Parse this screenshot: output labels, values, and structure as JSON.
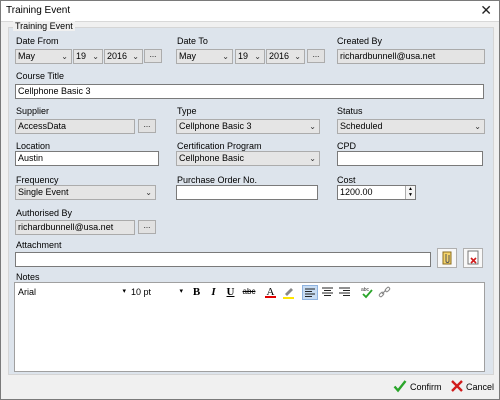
{
  "window": {
    "title": "Training Event"
  },
  "group": {
    "legend": "Training Event"
  },
  "date_from": {
    "label": "Date From",
    "month": "May",
    "day": "19",
    "year": "2016"
  },
  "date_to": {
    "label": "Date To",
    "month": "May",
    "day": "19",
    "year": "2016"
  },
  "created_by": {
    "label": "Created By",
    "value": "richardbunnell@usa.net"
  },
  "course_title": {
    "label": "Course Title",
    "value": "Cellphone Basic 3"
  },
  "supplier": {
    "label": "Supplier",
    "value": "AccessData"
  },
  "type": {
    "label": "Type",
    "value": "Cellphone Basic 3"
  },
  "status": {
    "label": "Status",
    "value": "Scheduled"
  },
  "location": {
    "label": "Location",
    "value": "Austin"
  },
  "certification_program": {
    "label": "Certification Program",
    "value": "Cellphone Basic"
  },
  "cpd": {
    "label": "CPD",
    "value": ""
  },
  "frequency": {
    "label": "Frequency",
    "value": "Single Event"
  },
  "purchase_order": {
    "label": "Purchase Order No.",
    "value": ""
  },
  "cost": {
    "label": "Cost",
    "value": "1200.00"
  },
  "authorised_by": {
    "label": "Authorised By",
    "value": "richardbunnell@usa.net"
  },
  "attachment": {
    "label": "Attachment",
    "value": ""
  },
  "notes": {
    "label": "Notes",
    "font": "Arial",
    "size": "10 pt",
    "bold": "B",
    "italic": "I",
    "underline": "U",
    "strike": "abc",
    "font_color": "A",
    "content": ""
  },
  "ellipsis": "...",
  "footer": {
    "confirm": "Confirm",
    "cancel": "Cancel"
  },
  "colors": {
    "confirm_icon": "#2aa52a",
    "cancel_icon": "#d11b1b",
    "font_color_bar": "#e00000",
    "highlight_bar": "#ffe600"
  }
}
